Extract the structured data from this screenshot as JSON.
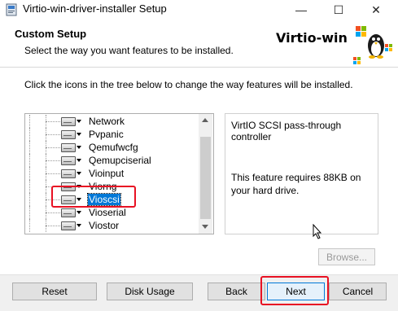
{
  "window": {
    "title": "Virtio-win-driver-installer Setup",
    "minimize_glyph": "—",
    "maximize_glyph": "☐",
    "close_glyph": "✕"
  },
  "header": {
    "title": "Custom Setup",
    "subtitle": "Select the way you want features to be installed.",
    "brand": "Virtio-win"
  },
  "instructions": "Click the icons in the tree below to change the way features will be installed.",
  "tree": {
    "items": [
      {
        "label": "Network"
      },
      {
        "label": "Pvpanic"
      },
      {
        "label": "Qemufwcfg"
      },
      {
        "label": "Qemupciserial"
      },
      {
        "label": "Vioinput"
      },
      {
        "label": "Viorng"
      },
      {
        "label": "Vioscsi",
        "selected": true
      },
      {
        "label": "Vioserial"
      },
      {
        "label": "Viostor"
      }
    ]
  },
  "description": {
    "title": "VirtIO SCSI pass-through controller",
    "size_text": "This feature requires 88KB on your hard drive."
  },
  "browse_label": "Browse...",
  "buttons": {
    "reset": "Reset",
    "disk_usage": "Disk Usage",
    "back": "Back",
    "next": "Next",
    "cancel": "Cancel"
  },
  "colors": {
    "selection": "#0078d7",
    "highlight": "#e81123"
  }
}
